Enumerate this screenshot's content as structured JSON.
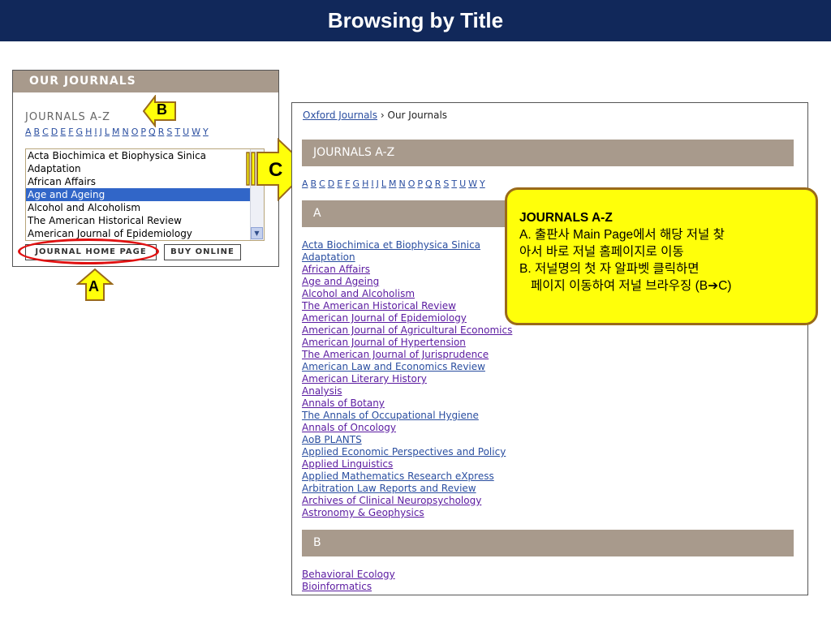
{
  "banner": {
    "title": "Browsing by Title"
  },
  "left_panel": {
    "header": "OUR JOURNALS",
    "az_title": "JOURNALS A-Z",
    "letters": [
      "A",
      "B",
      "C",
      "D",
      "E",
      "F",
      "G",
      "H",
      "I",
      "J",
      "L",
      "M",
      "N",
      "O",
      "P",
      "Q",
      "R",
      "S",
      "T",
      "U",
      "W",
      "Y"
    ],
    "list_items": [
      "Acta Biochimica et Biophysica Sinica",
      "Adaptation",
      "African Affairs",
      "Age and Ageing",
      "Alcohol and Alcoholism",
      "The American Historical Review",
      "American Journal of Epidemiology"
    ],
    "selected_item": "Age and Ageing",
    "home_button": "JOURNAL HOME PAGE",
    "buy_button": "BUY ONLINE"
  },
  "callouts": {
    "a": "A",
    "b": "B",
    "c": "C"
  },
  "right_panel": {
    "breadcrumb_link": "Oxford Journals",
    "breadcrumb_sep": "›",
    "breadcrumb_current": "Our Journals",
    "az_bar": "JOURNALS A-Z",
    "section_a": "A",
    "section_b": "B",
    "journals_a": [
      "Acta Biochimica et Biophysica Sinica",
      "Adaptation",
      "African Affairs",
      "Age and Ageing",
      "Alcohol and Alcoholism",
      "The American Historical Review",
      "American Journal of Epidemiology",
      "American Journal of Agricultural Economics",
      "American Journal of Hypertension",
      "The American Journal of Jurisprudence",
      "American Law and Economics Review",
      "American Literary History",
      "Analysis",
      "Annals of Botany",
      "The Annals of Occupational Hygiene",
      "Annals of Oncology",
      "AoB PLANTS",
      "Applied Economic Perspectives and Policy",
      "Applied Linguistics",
      "Applied Mathematics Research eXpress",
      "Arbitration Law Reports and Review",
      "Archives of Clinical Neuropsychology",
      "Astronomy & Geophysics"
    ],
    "journals_b": [
      "Behavioral Ecology",
      "Bioinformatics"
    ]
  },
  "note": {
    "title": "JOURNALS A-Z",
    "line1": "A. 출판사 Main Page에서 해당 저널 찾",
    "line2": "아서 바로 저널 홈페이지로 이동",
    "line3": "B. 저널명의 첫 자 알파벳 클릭하면",
    "line4": "페이지 이동하여 저널 브라우징 (B➔C)"
  },
  "colors": {
    "banner": "#11285a",
    "header_bar": "#a89a8c",
    "note_bg": "#ffff0a",
    "note_border": "#9a6a1a",
    "highlight": "#3166c8",
    "ellipse": "#e01010"
  }
}
